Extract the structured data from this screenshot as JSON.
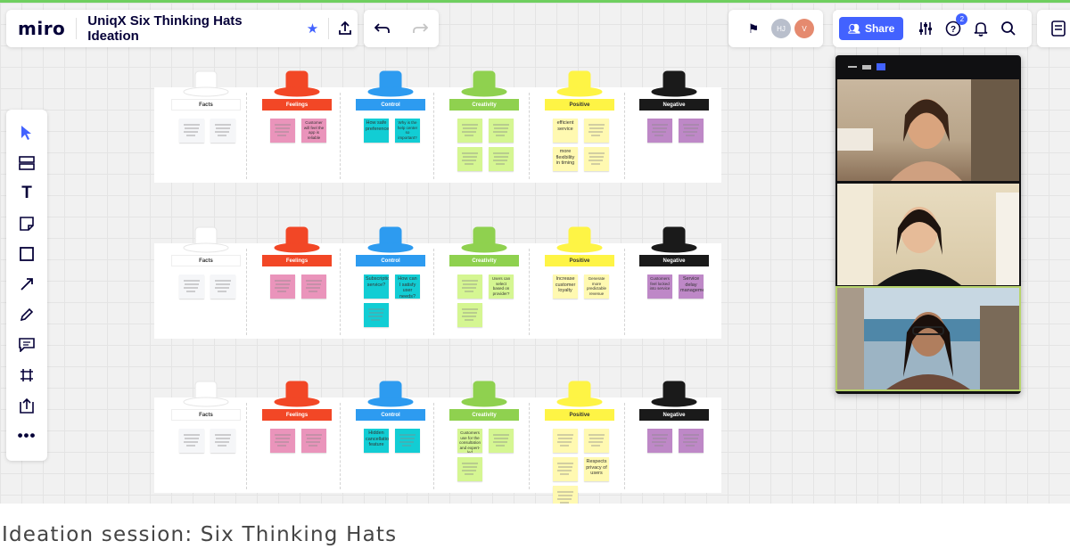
{
  "app": {
    "logo": "miro",
    "board_title": "UniqX Six Thinking Hats Ideation",
    "accent_color": "#4262ff",
    "top_line_color": "#6fcf5f"
  },
  "header": {
    "star_icon": "star-icon",
    "export_icon": "upload-icon",
    "undo_icon": "undo-icon",
    "redo_icon": "redo-icon",
    "collaborators": [
      {
        "initials": "HJ",
        "color": "#b9bfcc"
      },
      {
        "initials": "V",
        "color": "#e58a6f"
      }
    ],
    "share_label": "Share",
    "notifications_count": "2"
  },
  "toolbar": {
    "tools": [
      "select",
      "templates",
      "text",
      "sticky-note",
      "shape",
      "connection-line",
      "pen",
      "comment",
      "frame",
      "upload",
      "more"
    ]
  },
  "hats": [
    {
      "label": "Facts",
      "color": "#ffffff",
      "text": "#333333"
    },
    {
      "label": "Feelings",
      "color": "#f24726",
      "text": "#ffffff"
    },
    {
      "label": "Control",
      "color": "#2d9bf0",
      "text": "#ffffff"
    },
    {
      "label": "Creativity",
      "color": "#8fd14f",
      "text": "#ffffff"
    },
    {
      "label": "Positive",
      "color": "#fef445",
      "text": "#333333"
    },
    {
      "label": "Negative",
      "color": "#1a1a1a",
      "text": "#ffffff"
    }
  ],
  "note_colors": {
    "Facts": "#f5f6f8",
    "Feelings": "#ea94bb",
    "Control": "#12cdd4",
    "Creativity": "#d5f692",
    "Positive": "#fff9b1",
    "Negative": "#be88c7"
  },
  "panels": [
    {
      "notes": [
        {
          "col": 0,
          "texts": [
            "",
            ""
          ]
        },
        {
          "col": 1,
          "texts": [
            "",
            "Customer will feel the app is reliable"
          ]
        },
        {
          "col": 2,
          "texts": [
            "How safe preference?",
            "Why is the help center so important?"
          ]
        },
        {
          "col": 3,
          "texts": [
            "",
            "",
            "",
            ""
          ]
        },
        {
          "col": 4,
          "texts": [
            "efficient service",
            "",
            "more flexibility in timing",
            ""
          ]
        },
        {
          "col": 5,
          "texts": [
            "",
            ""
          ]
        }
      ]
    },
    {
      "notes": [
        {
          "col": 0,
          "texts": [
            "",
            ""
          ]
        },
        {
          "col": 1,
          "texts": [
            "",
            ""
          ]
        },
        {
          "col": 2,
          "texts": [
            "Subscription service?",
            "How can I satisfy user needs?",
            ""
          ]
        },
        {
          "col": 3,
          "texts": [
            "",
            "Users can select based on provider?",
            ""
          ]
        },
        {
          "col": 4,
          "texts": [
            "Increase customer loyalty",
            "Generate more predictable revenue"
          ]
        },
        {
          "col": 5,
          "texts": [
            "Customers feel locked into service",
            "Service delay management"
          ]
        }
      ]
    },
    {
      "notes": [
        {
          "col": 0,
          "texts": [
            "",
            ""
          ]
        },
        {
          "col": 1,
          "texts": [
            "",
            ""
          ]
        },
        {
          "col": 2,
          "texts": [
            "Hidden cancellation feature",
            ""
          ]
        },
        {
          "col": 3,
          "texts": [
            "Customers use for the consultation and expert-led knowledge",
            "",
            ""
          ]
        },
        {
          "col": 4,
          "texts": [
            "",
            "",
            "",
            "Respects privacy of users",
            ""
          ]
        },
        {
          "col": 5,
          "texts": [
            "",
            ""
          ]
        }
      ]
    }
  ],
  "video_panel": {
    "participants": 3
  },
  "caption": "Ideation session: Six Thinking Hats"
}
